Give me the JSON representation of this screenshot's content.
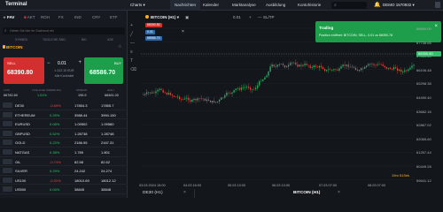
{
  "topbar": {
    "title": "Terminal",
    "chart_menu": "Charts ▾",
    "tabs": [
      "Nachrichten",
      "Kalender",
      "Marktanalyse",
      "Ausbildung",
      "Kontohistorie"
    ],
    "account": "DEMO 1570932 ▾"
  },
  "left": {
    "categories": [
      "FAV",
      "AKT",
      "ROH",
      "FX",
      "IND",
      "CRY",
      "ETF"
    ],
    "search_placeholder": "Geben Sie hier Ihr Suchwort ein",
    "col_headers": [
      "SYMBOL",
      "TÄGLICHE ÄND.",
      "BID",
      "ASK"
    ],
    "current_symbol": "BITCOIN",
    "sell_label": "SELL",
    "sell_price": "68390.80",
    "buy_label": "BUY",
    "buy_price": "68586.70",
    "qty": "0.01",
    "qty_sub": "± 312.10 EUR",
    "qty_sub2": "Alle Kontrakte",
    "stat_headers": [
      "LOW",
      "TÄGLICHE ÄNDERUNG",
      "SPREAD",
      "HIGH"
    ],
    "stat_values": [
      "66782.60",
      "1.51%",
      "195.9",
      "68461.00"
    ]
  },
  "instruments": [
    {
      "name": "DE30",
      "change": "-0.69%",
      "bid": "17854.3",
      "ask": "17855.7",
      "dir": "neg"
    },
    {
      "name": "ETHEREUM",
      "change": "0.25%",
      "bid": "3988.44",
      "ask": "3994.150",
      "dir": "pos"
    },
    {
      "name": "EURUSD",
      "change": "0.08%",
      "bid": "1.09502",
      "ask": "1.09560",
      "dir": "pos"
    },
    {
      "name": "GBPUSD",
      "change": "0.52%",
      "bid": "1.28738",
      "ask": "1.28748",
      "dir": "pos"
    },
    {
      "name": "GOLD",
      "change": "0.22%",
      "bid": "2166.95",
      "ask": "2167.31",
      "dir": "pos"
    },
    {
      "name": "NATGAS",
      "change": "0.38%",
      "bid": "1.789",
      "ask": "1.801",
      "dir": "pos"
    },
    {
      "name": "OIL",
      "change": "-0.74%",
      "bid": "82.58",
      "ask": "82.62",
      "dir": "neg"
    },
    {
      "name": "SILVER",
      "change": "0.29%",
      "bid": "24.242",
      "ask": "24.274",
      "dir": "pos"
    },
    {
      "name": "US100",
      "change": "-0.31%",
      "bid": "18010.69",
      "ask": "18012.12",
      "dir": "neg"
    },
    {
      "name": "US500",
      "change": "0.04%",
      "bid": "38845",
      "ask": "38848",
      "dir": "pos"
    }
  ],
  "chart": {
    "header": "BITCOIN (H1) ▾",
    "toolbar": [
      "▣",
      "0.01",
      "+",
      "—",
      "SL/TP"
    ],
    "pending_lines": [
      "68390.80",
      "0.01",
      "68586.70"
    ],
    "price_tag": "68390.80",
    "countdown": "19m 51Sek",
    "y_labels": [
      "68900.00",
      "67738.68",
      "67460.80",
      "66106.48",
      "65298.38",
      "64490.40",
      "63682.16",
      "62867.02",
      "62065.60",
      "61257.44",
      "60449.28",
      "59641.12"
    ],
    "x_labels": [
      "03.03 2024 15:00",
      "04.03 16:00",
      "05.03 13:00",
      "06.03 13:00",
      "07.03 07:00",
      "08.03 07:00"
    ],
    "bottom_tabs": [
      "DE30 (H1)",
      "BITCOIN (H1)"
    ]
  },
  "toast": {
    "title": "Trading",
    "message": "Position eröffnet: BITCOIN, SELL, 0.01 zu 68390.78"
  },
  "colors": {
    "up": "#2ec36a",
    "down": "#ef4444",
    "accent": "#ffb020",
    "toast": "#1e9e4a"
  }
}
